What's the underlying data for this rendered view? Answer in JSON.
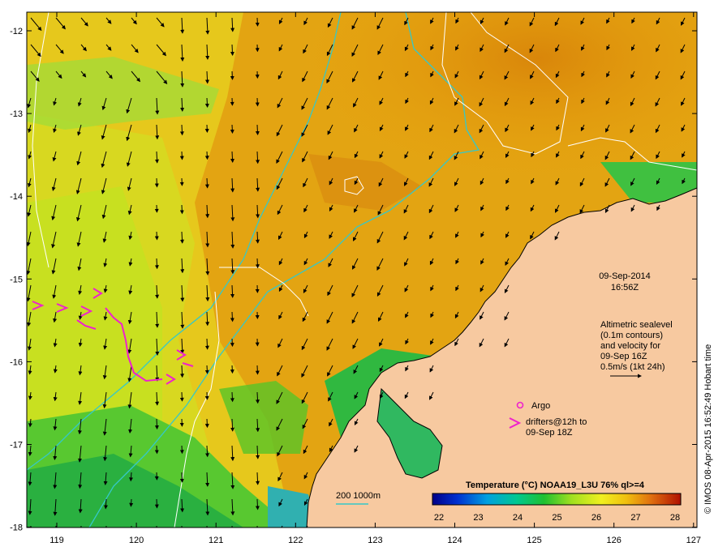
{
  "map": {
    "x_ticks": [
      "119",
      "120",
      "121",
      "122",
      "123",
      "124",
      "125",
      "126",
      "127"
    ],
    "y_ticks": [
      "-12",
      "-13",
      "-14",
      "-15",
      "-16",
      "-17",
      "-18"
    ],
    "date": "09-Sep-2014",
    "time": "16:56Z",
    "altimetry_note": [
      "Altimetric sealevel",
      "(0.1m contours)",
      "and velocity for",
      "09-Sep 16Z",
      "0.5m/s (1kt 24h)"
    ],
    "argo_label": "Argo",
    "drifter_label": [
      "drifters@12h to",
      "09-Sep 18Z"
    ],
    "depth_legend": "200  1000m",
    "colorbar_title": "Temperature (°C) NOAA19_L3U 76% ql>=4",
    "colorbar_ticks": [
      "22",
      "23",
      "24",
      "25",
      "26",
      "27",
      "28"
    ],
    "credit": "© IMOS 08-Apr-2015 16:52:49 Hobart time",
    "colors": {
      "land": "#f7c9a0",
      "warm": "#e0960a",
      "mid": "#e8d020",
      "cool": "#7ad020",
      "cold": "#28b040",
      "isobath": "#35c8c8",
      "contour": "#ffffff",
      "drifter": "#ee22cc"
    }
  }
}
